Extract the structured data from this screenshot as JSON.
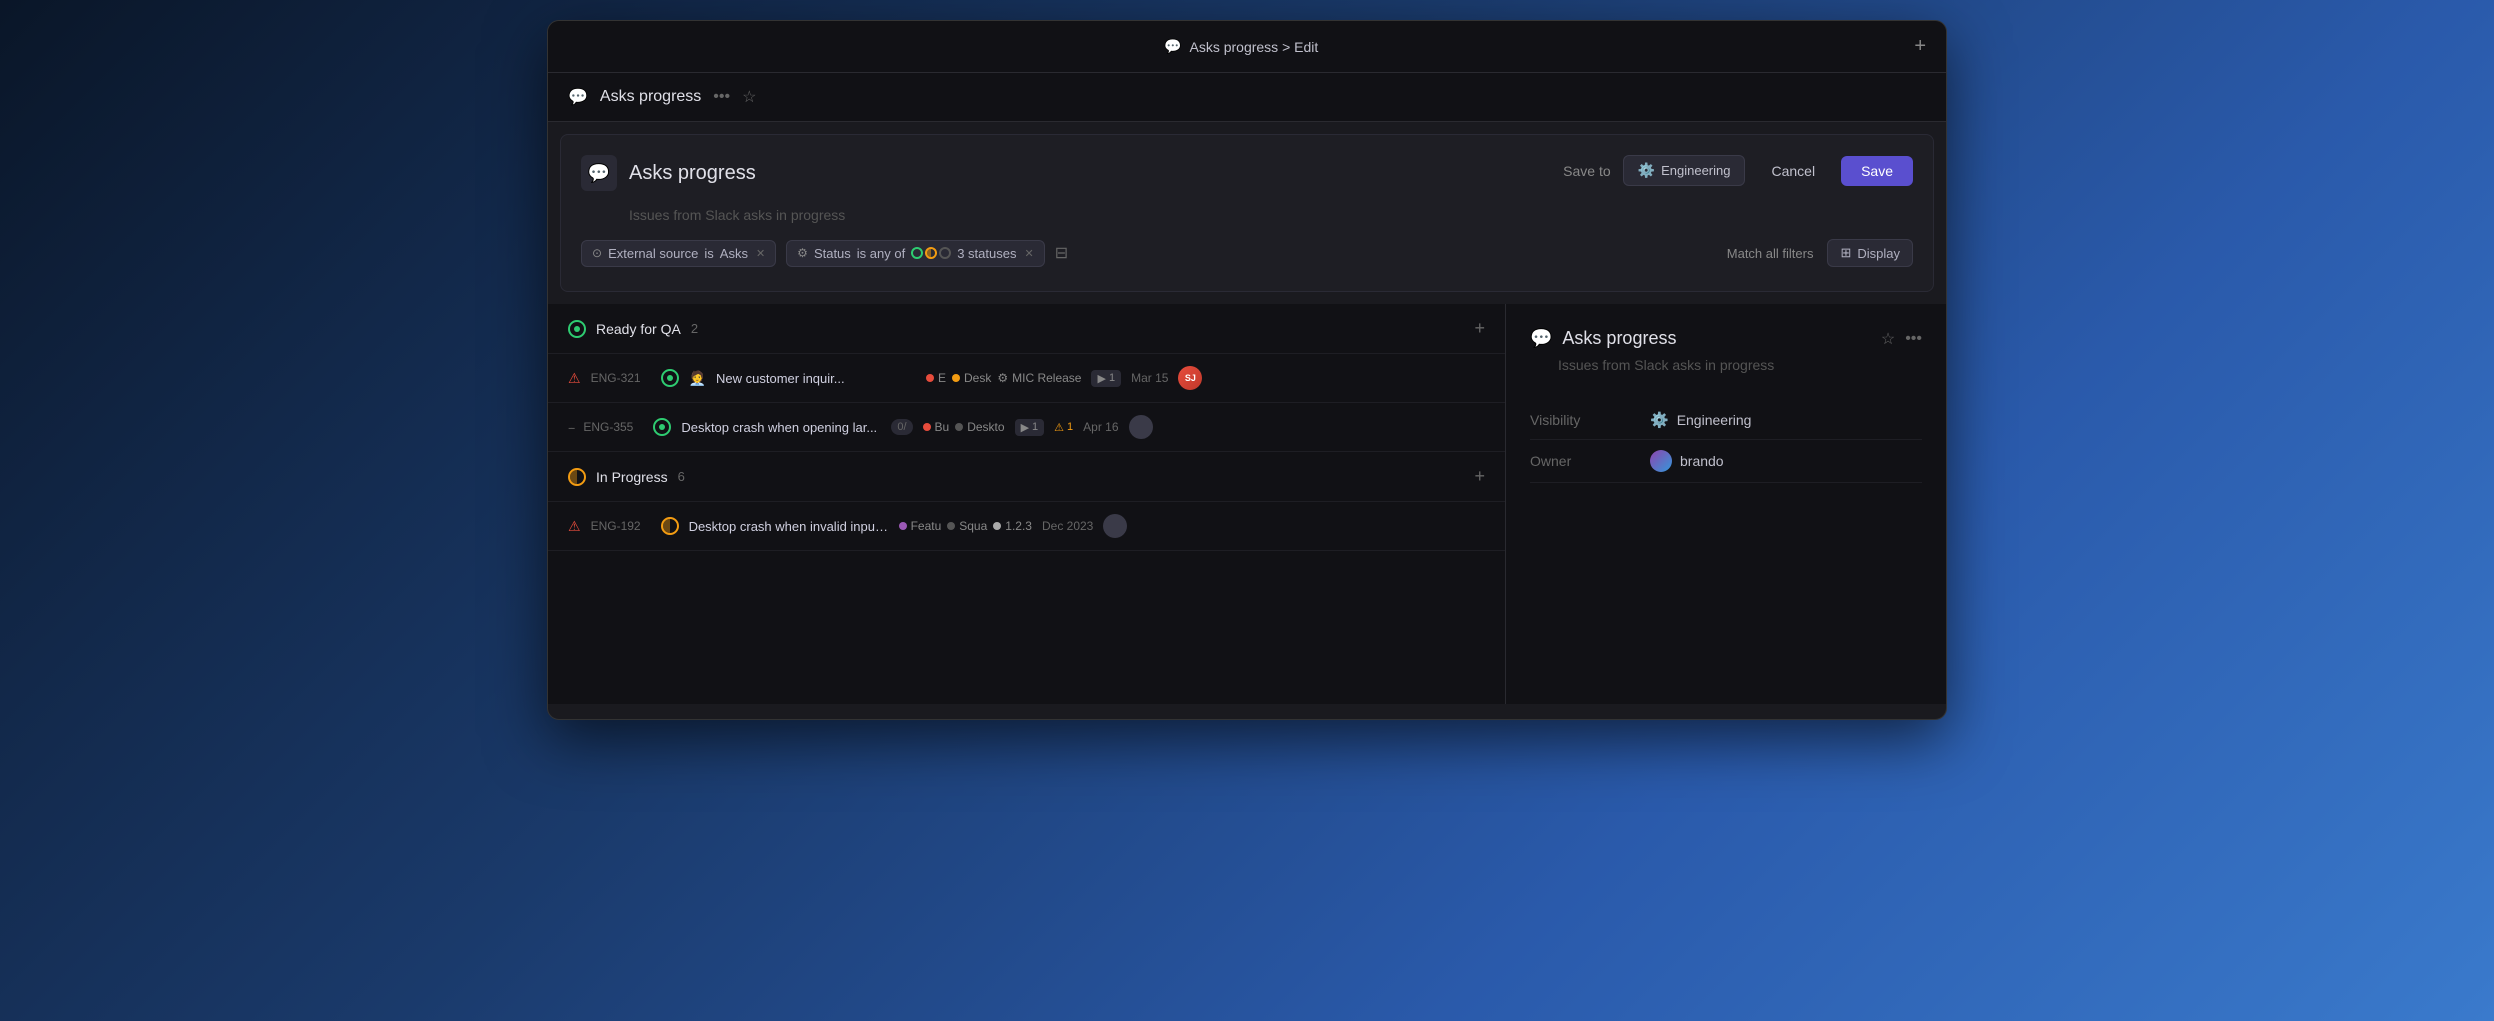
{
  "window": {
    "title": "Asks progress > Edit",
    "plus_label": "+"
  },
  "view_header": {
    "icon": "💬",
    "title": "Asks progress",
    "dots": "•••",
    "star": "☆"
  },
  "edit_area": {
    "icon": "💬",
    "title": "Asks progress",
    "description": "Issues from Slack asks in progress",
    "save_to_label": "Save to",
    "engineering_label": "Engineering",
    "cancel_label": "Cancel",
    "save_label": "Save"
  },
  "filters": {
    "external_source_label": "External source",
    "is_label": "is",
    "asks_label": "Asks",
    "status_label": "Status",
    "is_any_of_label": "is any of",
    "statuses_label": "3 statuses",
    "match_all_label": "Match all filters",
    "display_label": "Display"
  },
  "groups": [
    {
      "id": "ready-for-qa",
      "title": "Ready for QA",
      "count": "2",
      "issues": [
        {
          "priority": "urgent",
          "id": "ENG-321",
          "status": "ready",
          "emoji": "🧑‍💼",
          "title": "New customer inquir...",
          "tags": [
            "E",
            "Desk",
            "MIC Release"
          ],
          "play_count": "1",
          "date": "Mar 15",
          "avatar": "SJ"
        },
        {
          "priority": "dashes",
          "id": "ENG-355",
          "status": "ready",
          "emoji": null,
          "title": "Desktop crash when opening lar...",
          "sub_status": "0/",
          "tags": [
            "Bu",
            "Deskto"
          ],
          "play_count": "1",
          "warn_count": "1",
          "date": "Apr 16",
          "avatar": null
        }
      ]
    },
    {
      "id": "in-progress",
      "title": "In Progress",
      "count": "6",
      "issues": [
        {
          "priority": "urgent",
          "id": "ENG-192",
          "status": "in-progress",
          "emoji": null,
          "title": "Desktop crash when invalid input in ...",
          "tags": [
            "Featu",
            "Squa",
            "1.2.3"
          ],
          "play_count": null,
          "date": "Dec 2023",
          "avatar": null
        }
      ]
    }
  ],
  "right_panel": {
    "icon": "💬",
    "title": "Asks progress",
    "star": "☆",
    "dots": "•••",
    "description": "Issues from Slack asks in progress",
    "visibility_label": "Visibility",
    "visibility_value": "Engineering",
    "owner_label": "Owner",
    "owner_value": "brando"
  }
}
